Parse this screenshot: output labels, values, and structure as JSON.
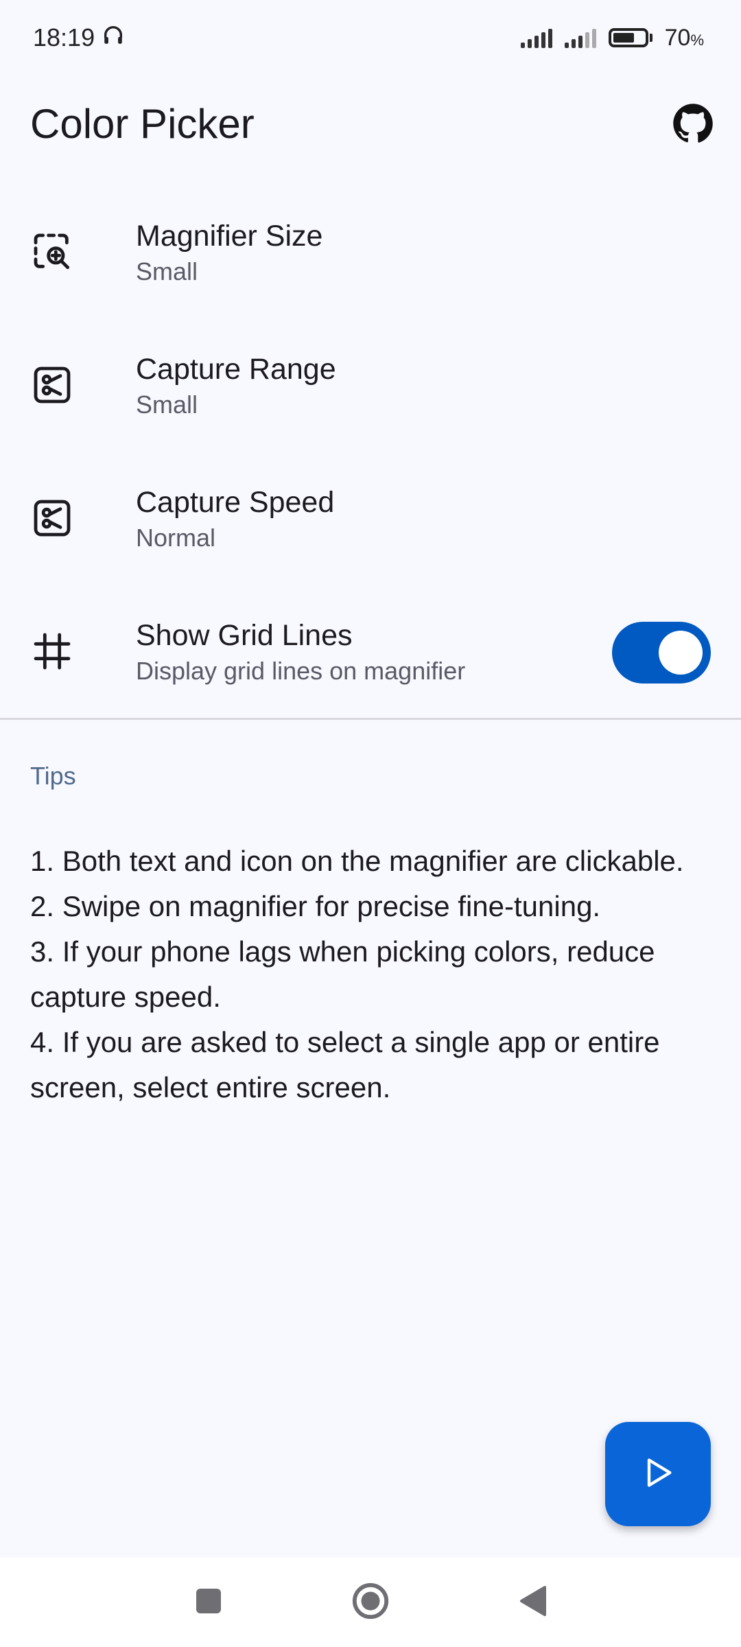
{
  "status_bar": {
    "time": "18:19",
    "battery_text": "70",
    "battery_unit": "%",
    "battery_level": 0.7
  },
  "app_bar": {
    "title": "Color Picker",
    "github_icon": "github-icon"
  },
  "settings": [
    {
      "title": "Magnifier Size",
      "subtitle": "Small",
      "icon": "magnifier-frame-icon"
    },
    {
      "title": "Capture Range",
      "subtitle": "Small",
      "icon": "scissors-box-icon"
    },
    {
      "title": "Capture Speed",
      "subtitle": "Normal",
      "icon": "scissors-box-icon"
    },
    {
      "title": "Show Grid Lines",
      "subtitle": "Display grid lines on magnifier",
      "icon": "grid-icon",
      "toggle_on": true
    }
  ],
  "tips": {
    "header": "Tips",
    "lines": [
      "1. Both text and icon on the magnifier are clickable.",
      "2. Swipe on magnifier for precise fine-tuning.",
      "3. If your phone lags when picking colors, reduce capture speed.",
      "4. If you are asked to select a single app or entire screen, select entire screen."
    ]
  },
  "fab": {
    "icon": "play-icon"
  },
  "nav": {
    "recents_icon": "square-icon",
    "home_icon": "home-circle-icon",
    "back_icon": "back-triangle-icon"
  },
  "colors": {
    "accent": "#005ac1",
    "fab": "#0a66d8",
    "background": "#f8f8ff",
    "tips_header": "#4f6a8a"
  }
}
